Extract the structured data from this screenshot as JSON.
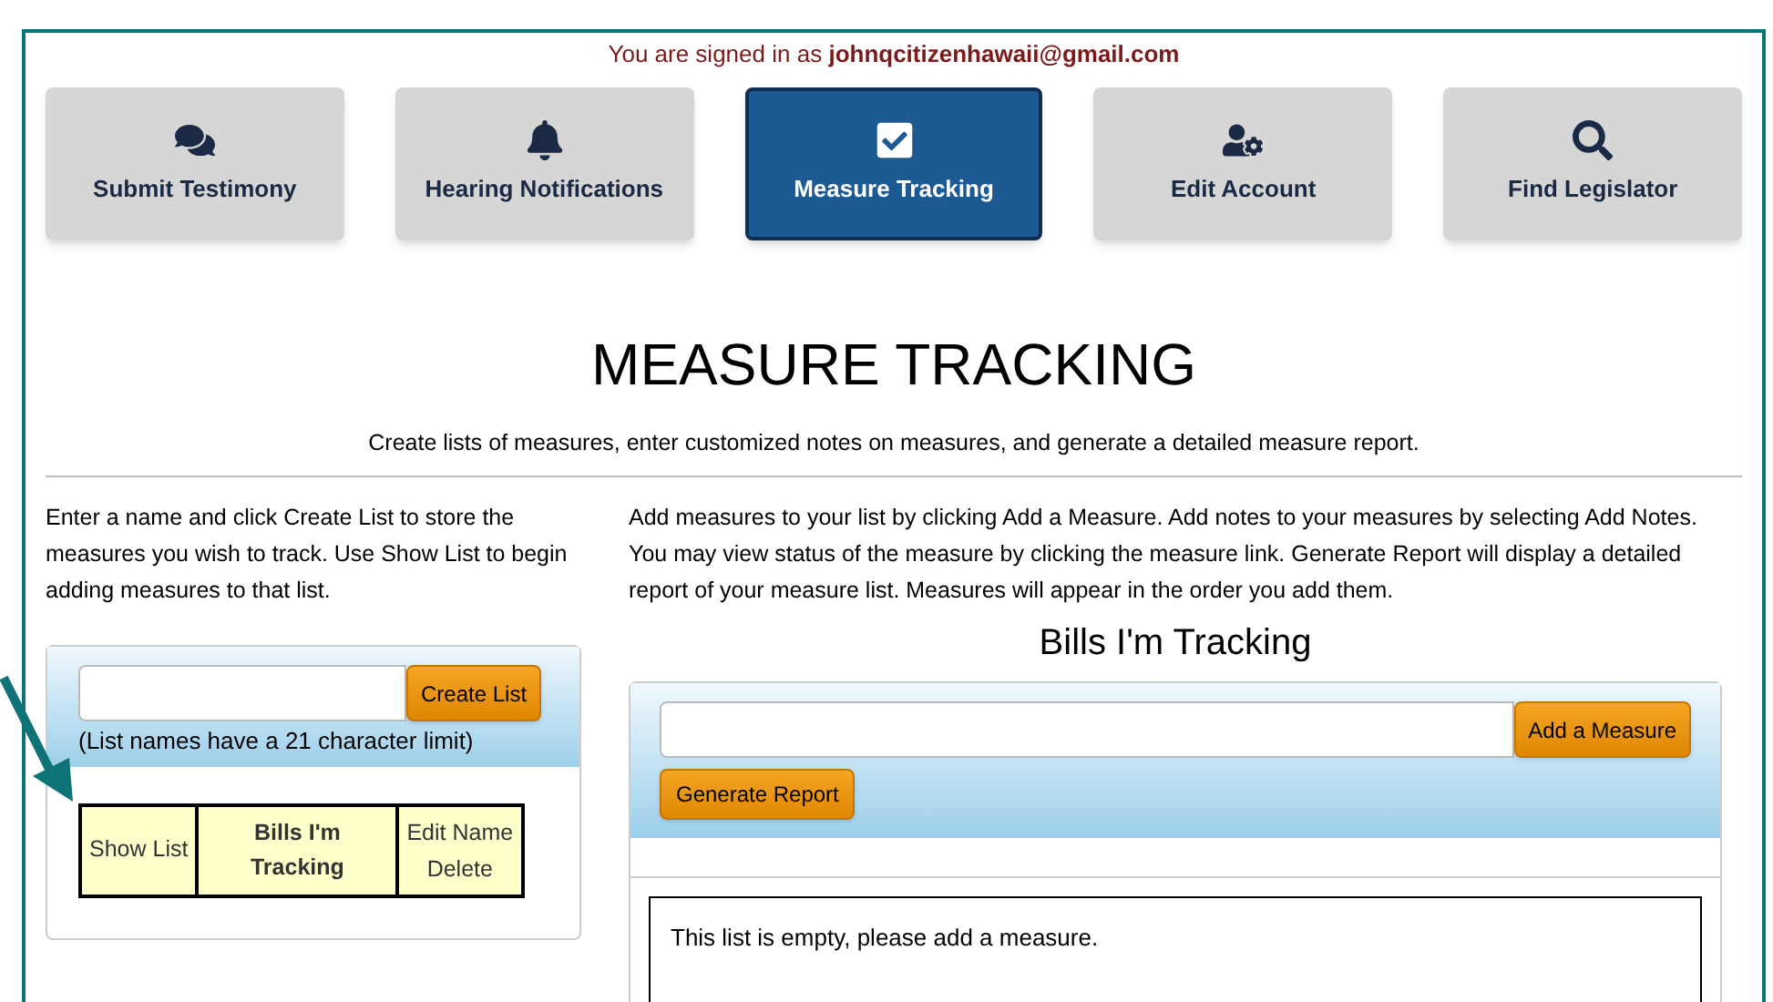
{
  "signed_in": {
    "prefix": "You are signed in as",
    "email": "johnqcitizenhawaii@gmail.com"
  },
  "nav": [
    {
      "label": "Submit Testimony",
      "selected": false
    },
    {
      "label": "Hearing Notifications",
      "selected": false
    },
    {
      "label": "Measure Tracking",
      "selected": true
    },
    {
      "label": "Edit Account",
      "selected": false
    },
    {
      "label": "Find Legislator",
      "selected": false
    }
  ],
  "page_title": "MEASURE TRACKING",
  "subtitle": "Create lists of measures, enter customized notes on measures, and generate a detailed measure report.",
  "left": {
    "instructions": "Enter a name and click Create List to store the measures you wish to track. Use Show List to begin adding measures to that list.",
    "create_button": "Create List",
    "limit_note": "(List names have a 21 character limit)",
    "lists": [
      {
        "show": "Show List",
        "name": "Bills I'm Tracking",
        "edit": "Edit Name",
        "delete": "Delete"
      }
    ]
  },
  "right": {
    "instructions": "Add measures to your list by clicking Add a Measure. Add notes to your measures by selecting Add Notes. You may view status of the measure by clicking the measure link. Generate Report will display a detailed report of your measure list. Measures will appear in the order you add them.",
    "list_title": "Bills I'm Tracking",
    "add_button": "Add a Measure",
    "report_button": "Generate Report",
    "empty_message": "This list is empty, please add a measure."
  }
}
